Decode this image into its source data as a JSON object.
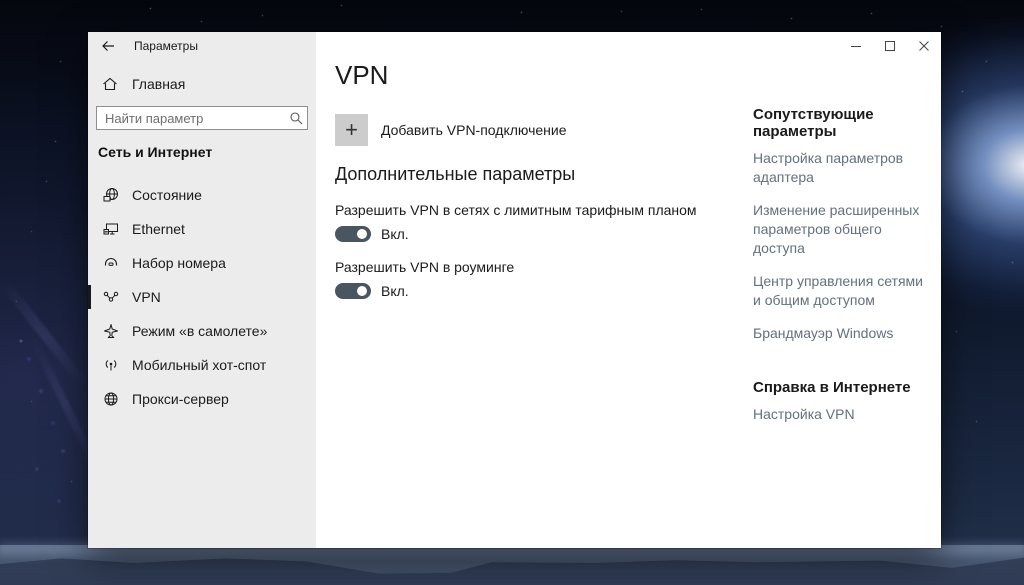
{
  "window": {
    "titlebar": {
      "back_title": "Параметры"
    }
  },
  "icons": {
    "plus": "+"
  },
  "sidebar": {
    "home_label": "Главная",
    "search_placeholder": "Найти параметр",
    "section_label": "Сеть и Интернет",
    "items": [
      {
        "label": "Состояние",
        "icon": "network-status-icon",
        "selected": false
      },
      {
        "label": "Ethernet",
        "icon": "ethernet-icon",
        "selected": false
      },
      {
        "label": "Набор номера",
        "icon": "dialup-icon",
        "selected": false
      },
      {
        "label": "VPN",
        "icon": "vpn-icon",
        "selected": true
      },
      {
        "label": "Режим «в самолете»",
        "icon": "airplane-icon",
        "selected": false
      },
      {
        "label": "Мобильный хот-спот",
        "icon": "hotspot-icon",
        "selected": false
      },
      {
        "label": "Прокси-сервер",
        "icon": "proxy-globe-icon",
        "selected": false
      }
    ]
  },
  "main": {
    "title": "VPN",
    "add_button_label": "Добавить VPN-подключение",
    "section_title": "Дополнительные параметры",
    "toggles": [
      {
        "label": "Разрешить VPN в сетях с лимитным тарифным планом",
        "state_label": "Вкл.",
        "on": true
      },
      {
        "label": "Разрешить VPN в роуминге",
        "state_label": "Вкл.",
        "on": true
      }
    ]
  },
  "related": {
    "title": "Сопутствующие параметры",
    "links": [
      "Настройка параметров адаптера",
      "Изменение расширенных параметров общего доступа",
      "Центр управления сетями и общим доступом",
      "Брандмауэр Windows"
    ]
  },
  "help": {
    "title": "Справка в Интернете",
    "links": [
      "Настройка VPN"
    ]
  },
  "colors": {
    "toggle_on": "#4a5562",
    "link": "#64707e",
    "sidebar_bg": "#ececec",
    "selection_bar": "#1a1a1a"
  }
}
